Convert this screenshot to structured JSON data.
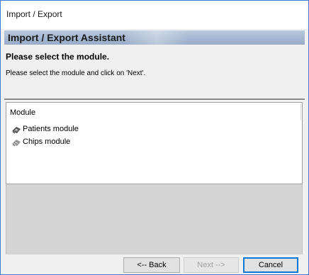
{
  "window": {
    "title": "Import / Export"
  },
  "assistant": {
    "banner_title": "Import / Export Assistant",
    "heading": "Please select the module.",
    "instruction": "Please select the module and click on 'Next'."
  },
  "module_list": {
    "column_header": "Module",
    "items": [
      {
        "label": "Patients module",
        "icon": "patients-module-icon"
      },
      {
        "label": "Chips module",
        "icon": "chips-module-icon"
      }
    ]
  },
  "buttons": {
    "back": "<-- Back",
    "next": "Next -->",
    "cancel": "Cancel",
    "next_enabled": false
  },
  "colors": {
    "window_border": "#3c78d8",
    "banner": "#a8bad4",
    "dialog_background": "#f0f0f0",
    "empty_area": "#d4d4d4",
    "default_button_border": "#0078d7"
  }
}
